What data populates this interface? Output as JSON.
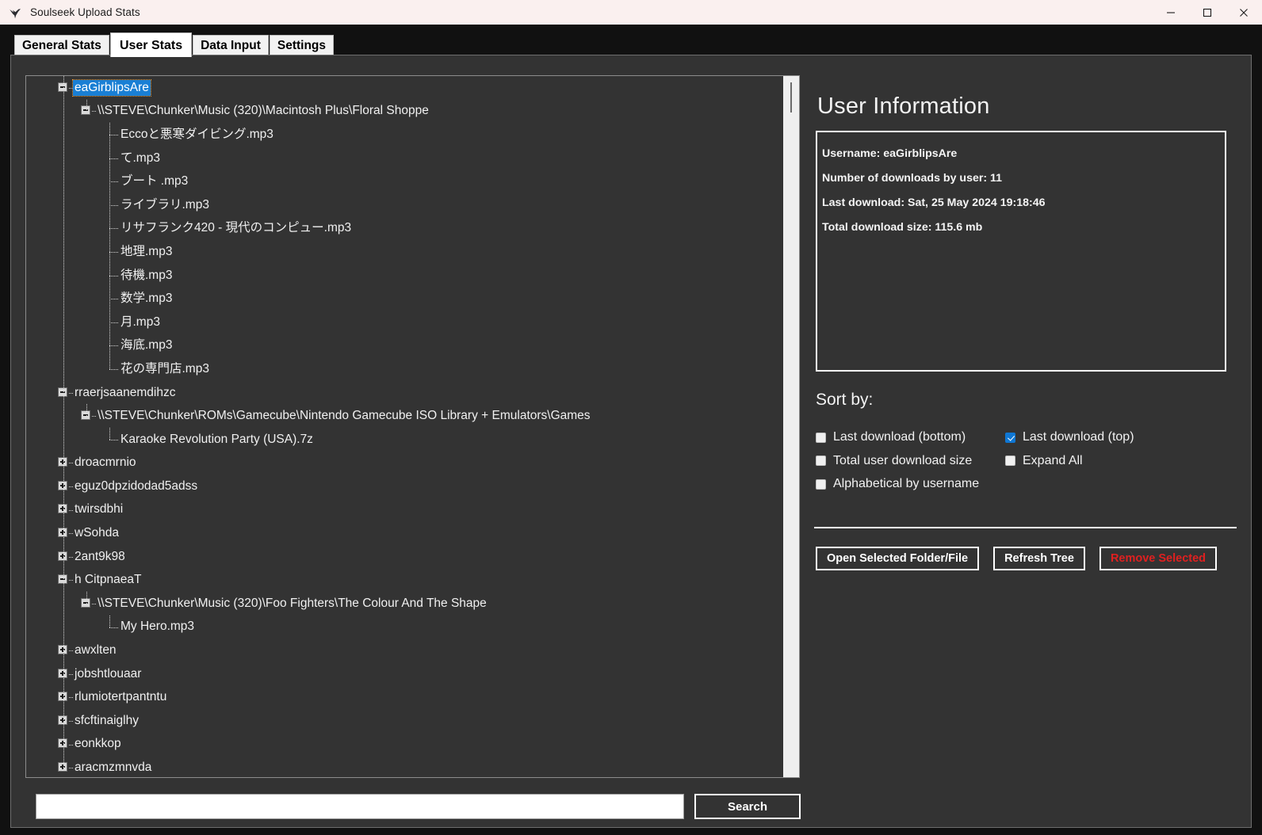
{
  "window": {
    "title": "Soulseek Upload Stats",
    "app_icon": "bird-icon",
    "controls": {
      "minimize": "minimize-icon",
      "maximize": "maximize-icon",
      "close": "close-icon"
    }
  },
  "tabs": [
    {
      "label": "General Stats",
      "active": false
    },
    {
      "label": "User Stats",
      "active": true
    },
    {
      "label": "Data Input",
      "active": false
    },
    {
      "label": "Settings",
      "active": false
    }
  ],
  "tree": [
    {
      "depth": 0,
      "label": "eaGirblipsAre",
      "state": "expanded",
      "selected": true
    },
    {
      "depth": 1,
      "label": "\\\\STEVE\\Chunker\\Music (320)\\Macintosh Plus\\Floral Shoppe",
      "state": "expanded",
      "selected": false
    },
    {
      "depth": 2,
      "label": "Eccoと悪寒ダイビング.mp3",
      "state": "leaf",
      "selected": false
    },
    {
      "depth": 2,
      "label": "て.mp3",
      "state": "leaf",
      "selected": false
    },
    {
      "depth": 2,
      "label": "ブート .mp3",
      "state": "leaf",
      "selected": false
    },
    {
      "depth": 2,
      "label": "ライブラリ.mp3",
      "state": "leaf",
      "selected": false
    },
    {
      "depth": 2,
      "label": "リサフランク420 - 現代のコンピュー.mp3",
      "state": "leaf",
      "selected": false
    },
    {
      "depth": 2,
      "label": "地理.mp3",
      "state": "leaf",
      "selected": false
    },
    {
      "depth": 2,
      "label": "待機.mp3",
      "state": "leaf",
      "selected": false
    },
    {
      "depth": 2,
      "label": "数学.mp3",
      "state": "leaf",
      "selected": false
    },
    {
      "depth": 2,
      "label": "月.mp3",
      "state": "leaf",
      "selected": false
    },
    {
      "depth": 2,
      "label": "海底.mp3",
      "state": "leaf",
      "selected": false
    },
    {
      "depth": 2,
      "label": "花の専門店.mp3",
      "state": "leaf",
      "selected": false
    },
    {
      "depth": 0,
      "label": "rraerjsaanemdihzc",
      "state": "expanded",
      "selected": false
    },
    {
      "depth": 1,
      "label": "\\\\STEVE\\Chunker\\ROMs\\Gamecube\\Nintendo Gamecube ISO Library + Emulators\\Games",
      "state": "expanded",
      "selected": false
    },
    {
      "depth": 2,
      "label": "Karaoke Revolution Party (USA).7z",
      "state": "leaf",
      "selected": false
    },
    {
      "depth": 0,
      "label": "droacmrnio",
      "state": "collapsed",
      "selected": false
    },
    {
      "depth": 0,
      "label": "eguz0dpzidodad5adss",
      "state": "collapsed",
      "selected": false
    },
    {
      "depth": 0,
      "label": "twirsdbhi",
      "state": "collapsed",
      "selected": false
    },
    {
      "depth": 0,
      "label": "wSohda",
      "state": "collapsed",
      "selected": false
    },
    {
      "depth": 0,
      "label": "2ant9k98",
      "state": "collapsed",
      "selected": false
    },
    {
      "depth": 0,
      "label": "h CitpnaeaT",
      "state": "expanded",
      "selected": false
    },
    {
      "depth": 1,
      "label": "\\\\STEVE\\Chunker\\Music (320)\\Foo Fighters\\The Colour And The Shape",
      "state": "expanded",
      "selected": false
    },
    {
      "depth": 2,
      "label": "My Hero.mp3",
      "state": "leaf",
      "selected": false
    },
    {
      "depth": 0,
      "label": "awxlten",
      "state": "collapsed",
      "selected": false
    },
    {
      "depth": 0,
      "label": "jobshtlouaar",
      "state": "collapsed",
      "selected": false
    },
    {
      "depth": 0,
      "label": "rlumiotertpantntu",
      "state": "collapsed",
      "selected": false
    },
    {
      "depth": 0,
      "label": "sfcftinaiglhy",
      "state": "collapsed",
      "selected": false
    },
    {
      "depth": 0,
      "label": "eonkkop",
      "state": "collapsed",
      "selected": false
    },
    {
      "depth": 0,
      "label": "aracmzmnvda",
      "state": "collapsed",
      "selected": false
    }
  ],
  "search": {
    "value": "",
    "placeholder": "",
    "button_label": "Search"
  },
  "user_info": {
    "heading": "User Information",
    "lines": [
      "Username: eaGirblipsAre",
      "Number of downloads by user: 11",
      "Last download: Sat, 25 May 2024 19:18:46",
      "Total download size: 115.6 mb"
    ]
  },
  "sort": {
    "heading": "Sort by:",
    "options": [
      {
        "label": "Last download (bottom)",
        "checked": false
      },
      {
        "label": "Last download (top)",
        "checked": true
      },
      {
        "label": "Total user download size",
        "checked": false
      },
      {
        "label": "Expand All",
        "checked": false
      },
      {
        "label": "Alphabetical by username",
        "checked": false
      }
    ]
  },
  "actions": [
    {
      "label": "Open Selected Folder/File",
      "style": "normal"
    },
    {
      "label": "Refresh Tree",
      "style": "normal"
    },
    {
      "label": "Remove Selected",
      "style": "danger"
    }
  ],
  "colors": {
    "titlebar": "#faf0ef",
    "panel_bg": "#333333",
    "app_bg": "#111111",
    "selection": "#1a7fd4",
    "checkbox_checked": "#0f77d4",
    "danger_text": "#e02020",
    "text": "#f2f2f2"
  }
}
